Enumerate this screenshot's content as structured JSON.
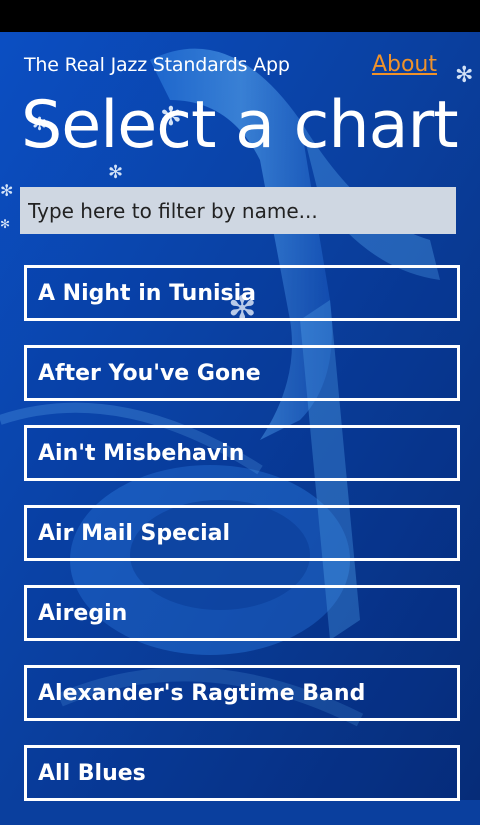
{
  "app": {
    "title": "The Real Jazz Standards App"
  },
  "header": {
    "about_label": "About"
  },
  "page": {
    "title": "Select a chart"
  },
  "filter": {
    "placeholder": "Type here to filter by name..."
  },
  "charts": [
    {
      "name": "A Night in Tunisia"
    },
    {
      "name": "After You've Gone"
    },
    {
      "name": "Ain't Misbehavin"
    },
    {
      "name": "Air Mail Special"
    },
    {
      "name": "Airegin"
    },
    {
      "name": "Alexander's Ragtime Band"
    },
    {
      "name": "All Blues"
    }
  ],
  "colors": {
    "accent": "#f0922a",
    "background": "#0a3f9e"
  }
}
